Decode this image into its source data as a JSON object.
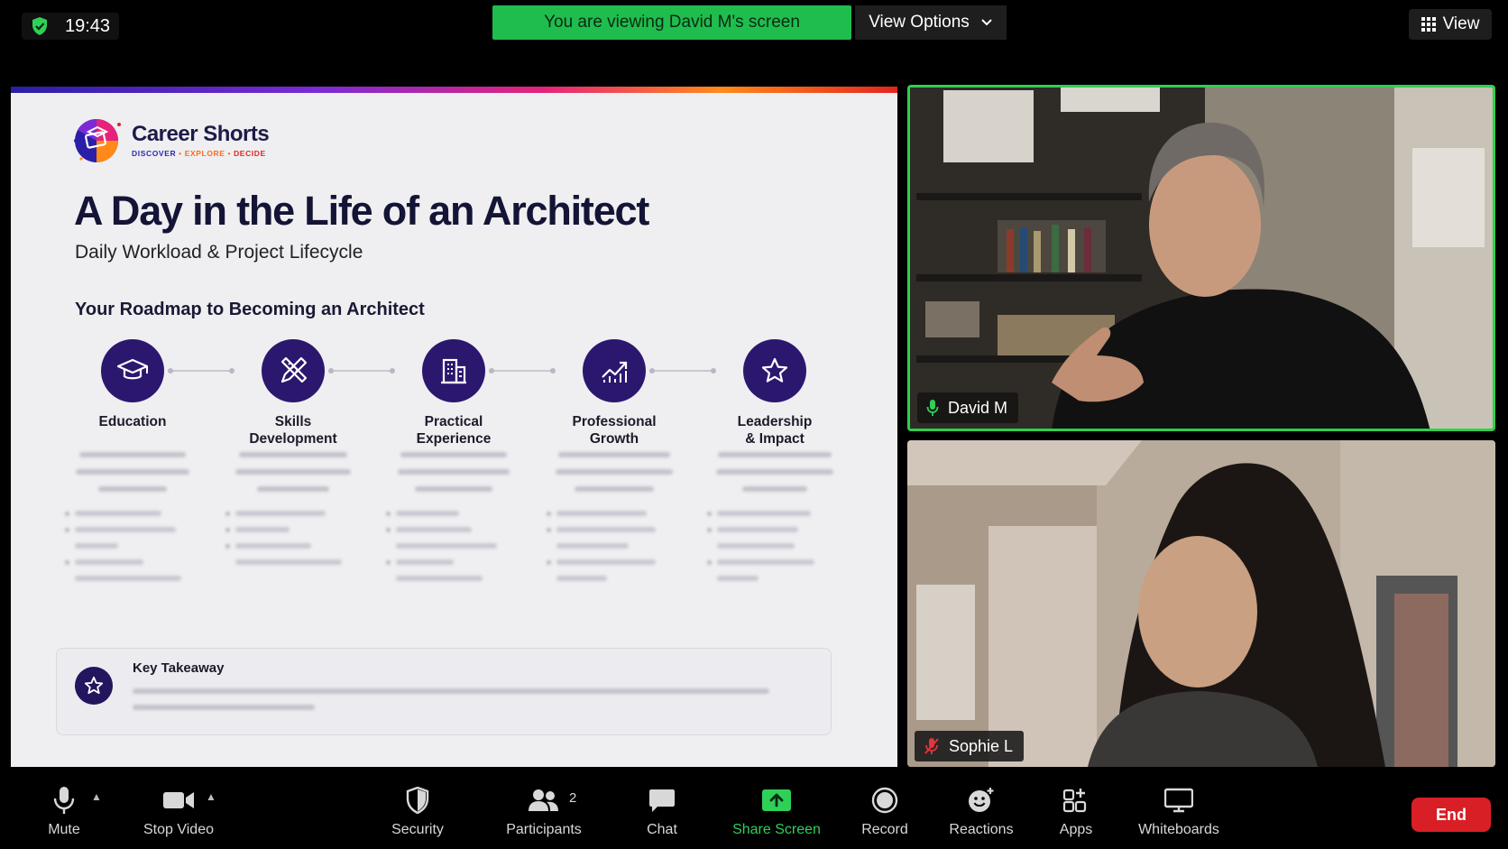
{
  "topbar": {
    "time": "19:43",
    "viewing_banner": "You are viewing David M's screen",
    "view_options_label": "View Options",
    "view_label": "View"
  },
  "slide": {
    "brand_name": "Career Shorts",
    "brand_tag": [
      "DISCOVER",
      "EXPLORE",
      "DECIDE"
    ],
    "title": "A Day in the Life of an Architect",
    "subtitle": "Daily Workload & Project Lifecycle",
    "roadmap_heading": "Your Roadmap to Becoming an Architect",
    "steps": [
      {
        "line1": "Education",
        "line2": "",
        "icon": "graduation-cap-icon"
      },
      {
        "line1": "Skills",
        "line2": "Development",
        "icon": "pencil-ruler-icon"
      },
      {
        "line1": "Practical",
        "line2": "Experience",
        "icon": "building-icon"
      },
      {
        "line1": "Professional",
        "line2": "Growth",
        "icon": "growth-chart-icon"
      },
      {
        "line1": "Leadership",
        "line2": "& Impact",
        "icon": "star-icon"
      }
    ],
    "key_takeaway_title": "Key Takeaway"
  },
  "participants": [
    {
      "name": "David M",
      "muted": false,
      "speaking": true
    },
    {
      "name": "Sophie L",
      "muted": true,
      "speaking": false
    }
  ],
  "toolbar": {
    "mute": "Mute",
    "stop_video": "Stop Video",
    "security": "Security",
    "participants": "Participants",
    "participants_count": "2",
    "chat": "Chat",
    "share_screen": "Share Screen",
    "record": "Record",
    "reactions": "Reactions",
    "apps": "Apps",
    "whiteboards": "Whiteboards",
    "end": "End"
  },
  "colors": {
    "share_green": "#2fd058",
    "end_red": "#d81f26",
    "step_purple": "#2c176f"
  }
}
